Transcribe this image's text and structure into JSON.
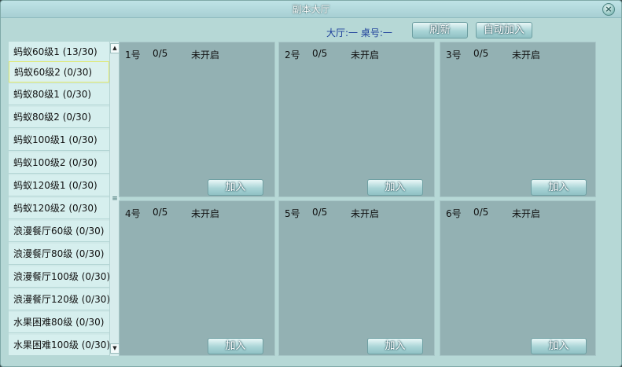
{
  "window": {
    "title": "副本大厅"
  },
  "header": {
    "hall_info": "大厅:一 桌号:一",
    "refresh_label": "刷新",
    "auto_join_label": "自动加入"
  },
  "rooms": [
    "蚂蚁60级1 (13/30)",
    "蚂蚁60级2 (0/30)",
    "蚂蚁80级1 (0/30)",
    "蚂蚁80级2 (0/30)",
    "蚂蚁100级1 (0/30)",
    "蚂蚁100级2 (0/30)",
    "蚂蚁120级1 (0/30)",
    "蚂蚁120级2 (0/30)",
    "浪漫餐厅60级 (0/30)",
    "浪漫餐厅80级 (0/30)",
    "浪漫餐厅100级 (0/30)",
    "浪漫餐厅120级 (0/30)",
    "水果困难80级 (0/30)",
    "水果困难100级 (0/30)"
  ],
  "selected_room_index": 1,
  "tables": [
    {
      "num": "1号",
      "count": "0/5",
      "status": "未开启",
      "join_label": "加入"
    },
    {
      "num": "2号",
      "count": "0/5",
      "status": "未开启",
      "join_label": "加入"
    },
    {
      "num": "3号",
      "count": "0/5",
      "status": "未开启",
      "join_label": "加入"
    },
    {
      "num": "4号",
      "count": "0/5",
      "status": "未开启",
      "join_label": "加入"
    },
    {
      "num": "5号",
      "count": "0/5",
      "status": "未开启",
      "join_label": "加入"
    },
    {
      "num": "6号",
      "count": "0/5",
      "status": "未开启",
      "join_label": "加入"
    }
  ],
  "icons": {
    "close": "close-icon",
    "scroll_up": "arrow-up-icon",
    "scroll_down": "arrow-down-icon",
    "scroll_grip": "grip-icon"
  },
  "colors": {
    "window_bg": "#b6d8d6",
    "table_bg": "#93b1b3",
    "info_text": "#1d3f9a",
    "selected_border": "#e1e96a"
  }
}
